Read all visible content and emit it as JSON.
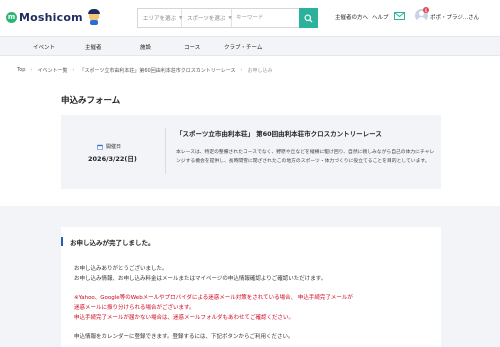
{
  "header": {
    "logo_text": "Moshicom",
    "search": {
      "area_label": "エリアを選ぶ",
      "sport_label": "スポーツを選ぶ",
      "keyword_placeholder": "キーワード"
    },
    "organizer_link": "主催者の方へ",
    "help_link": "ヘルプ",
    "notification_count": "6",
    "user_name": "ポポ・プラジ...さん"
  },
  "nav": {
    "items": [
      "イベント",
      "主催者",
      "施設",
      "コース",
      "クラブ・チーム"
    ]
  },
  "breadcrumb": [
    "Top",
    "イベント一覧",
    "「スポーツ立市由利本荘」第60回由利本荘市クロスカントリーレース",
    "お申し込み"
  ],
  "page_title": "申込みフォーム",
  "event": {
    "date_label": "開催日",
    "date_value": "2026/3/22(日)",
    "title": "「スポーツ立市由利本荘」 第60回由利本荘市クロスカントリーレース",
    "description": "本レースは、特定の整備されたコースでなく、野原や丘などを縦横に駆け回り、自然に親しみながら自己の体力にチャレンジする機会を提供し、長時間雪に閉ざされたこの地方のスポーツ・体力づくりに役立てることを目的としています。"
  },
  "confirmation": {
    "heading": "お申し込みが完了しました。",
    "lines": [
      "お申し込みありがとうございました。",
      "お申し込み情報、お申し込み料金はメールまたはマイページの申込情報確認よりご確認いただけます。"
    ],
    "warning_lines": [
      "※Yahoo、Google等のWebメールやプロバイダによる迷惑メール対策をされている場合、 申込手続完了メールが",
      "迷惑メールに振り分けられる場合がございます。",
      "申込手続完了メールが届かない場合は、迷惑メールフォルダもあわせてご確認ください。"
    ],
    "calendar_line": "申込情報をカレンダーに登録できます。登録するには、下記ボタンからご利用ください。"
  },
  "colors": {
    "brand_green": "#2bb673",
    "search_button": "#2bb29a",
    "heading_accent": "#2a5db0",
    "warning_red": "#d0021b"
  }
}
